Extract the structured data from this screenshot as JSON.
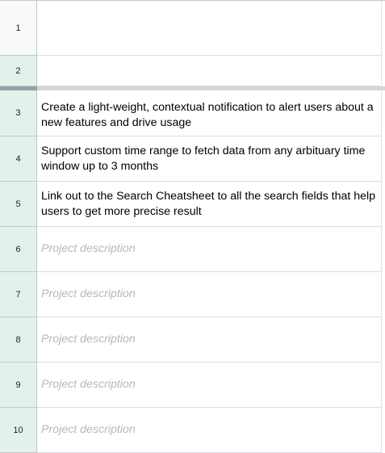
{
  "rows": [
    {
      "number": "1",
      "text": "",
      "placeholder": false
    },
    {
      "number": "2",
      "text": "",
      "placeholder": false
    },
    {
      "number": "3",
      "text": "Create a light-weight, contextual notification to alert users about a new features and drive usage",
      "placeholder": false
    },
    {
      "number": "4",
      "text": "Support custom time range to fetch data from any arbituary time window up to 3 months",
      "placeholder": false
    },
    {
      "number": "5",
      "text": "Link out to the Search Cheatsheet to all the search fields that help users to get more precise result",
      "placeholder": false
    },
    {
      "number": "6",
      "text": "Project description",
      "placeholder": true
    },
    {
      "number": "7",
      "text": "Project description",
      "placeholder": true
    },
    {
      "number": "8",
      "text": "Project description",
      "placeholder": true
    },
    {
      "number": "9",
      "text": "Project description",
      "placeholder": true
    },
    {
      "number": "10",
      "text": "Project description",
      "placeholder": true
    }
  ],
  "colors": {
    "row_header_plain": "#f8f9fa",
    "row_header_selected": "#e2f2ea",
    "gridline": "#dadce0",
    "placeholder_text": "#b4b8bc",
    "freeze_bar": "#d3d6da"
  }
}
